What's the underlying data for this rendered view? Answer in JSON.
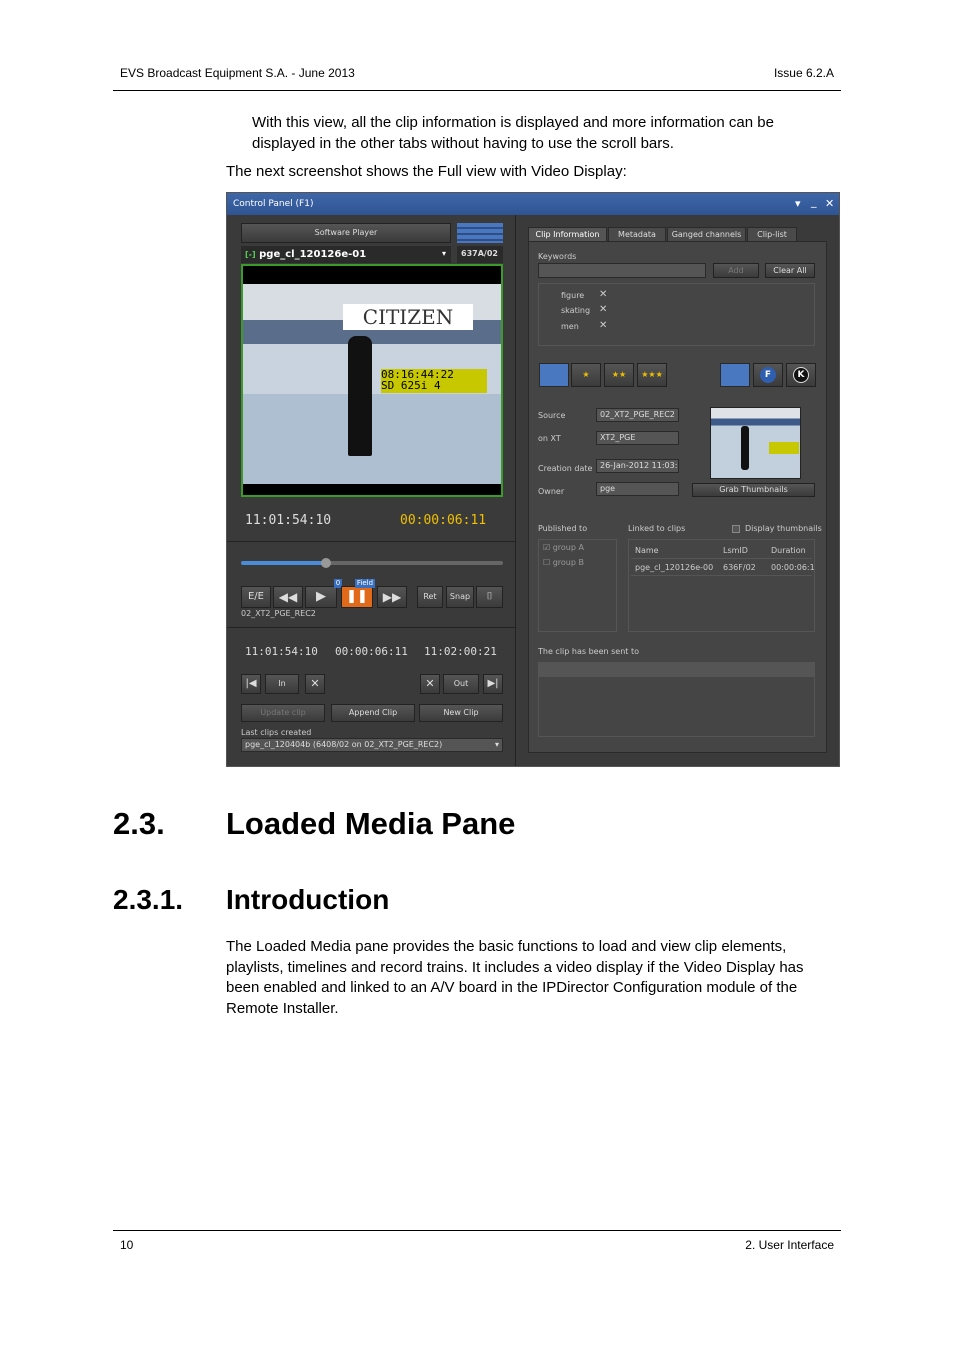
{
  "header": {
    "left": "EVS Broadcast Equipment S.A.  - June 2013",
    "right": "Issue 6.2.A"
  },
  "intro_text": "With this view, all the clip information is displayed and more information can be displayed in the other tabs without having to use the scroll bars.",
  "caption": "The next screenshot shows the Full view with Video Display:",
  "control_panel": {
    "title": "Control Panel (F1)",
    "window_controls": [
      "▾",
      "_",
      "✕"
    ],
    "player_button": "Software Player",
    "clip_name": "pge_cl_120126e-01",
    "clip_id": "637A/02",
    "video_overlay_tc": "08:16:44:22",
    "video_overlay_std": "SD  625i  4",
    "video_banner": "CITIZEN",
    "timecode_current": "11:01:54:10",
    "timecode_remaining": "00:00:06:11",
    "transport": {
      "ee": "E/E",
      "field_label": "Field",
      "counter": "0",
      "ret": "Ret",
      "snap": "Snap"
    },
    "source_label": "02_XT2_PGE_REC2",
    "tc_in": "11:01:54:10",
    "tc_duration": "00:00:06:11",
    "tc_out": "11:02:00:21",
    "in_button": "In",
    "out_button": "Out",
    "update_clip": "Update clip",
    "append_clip": "Append Clip",
    "new_clip": "New Clip",
    "last_clips_label": "Last clips created",
    "last_clip_value": "pge_cl_120404b (6408/02 on 02_XT2_PGE_REC2)",
    "tabs": [
      "Clip Information",
      "Metadata",
      "Ganged channels",
      "Clip-list"
    ],
    "keywords_label": "Keywords",
    "add_button": "Add",
    "clear_all_button": "Clear All",
    "keywords": [
      "figure",
      "skating",
      "men"
    ],
    "ratings": [
      "★",
      "★★",
      "★★★"
    ],
    "f_badge": "F",
    "k_badge": "K",
    "source_field_label": "Source",
    "source_value": "02_XT2_PGE_REC2",
    "on_xt_label": "on XT",
    "on_xt_value": "XT2_PGE",
    "creation_label": "Creation date",
    "creation_value": "26-Jan-2012 11:03:1",
    "owner_label": "Owner",
    "owner_value": "pge",
    "grab_thumbnails": "Grab Thumbnails",
    "published_label": "Published to",
    "linked_label": "Linked to clips",
    "display_thumbs": "Display thumbnails",
    "groups": [
      "group A",
      "group B"
    ],
    "linked_headers": [
      "Name",
      "LsmID",
      "Duration"
    ],
    "linked_row": [
      "pge_cl_120126e-00",
      "636F/02",
      "00:00:06:1"
    ],
    "sent_label": "The clip has been sent to"
  },
  "section": {
    "number": "2.3.",
    "title": "Loaded Media Pane"
  },
  "subsection": {
    "number": "2.3.1.",
    "title": "Introduction"
  },
  "body_text": "The Loaded Media pane provides the basic functions to load and view clip elements, playlists, timelines and record trains. It includes a video display if the Video Display has been enabled and linked to an A/V board in the IPDirector Configuration module of the Remote Installer.",
  "footer": {
    "left": "10",
    "right": "2. User Interface"
  }
}
